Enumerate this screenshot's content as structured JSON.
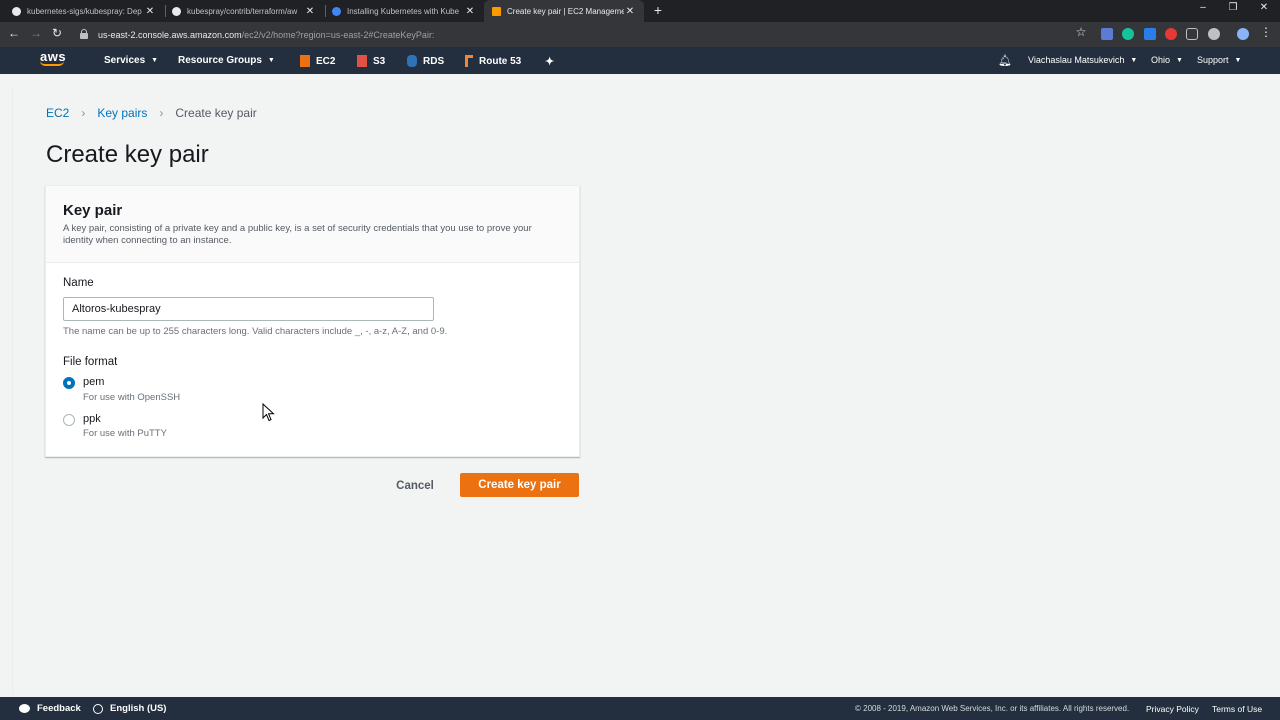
{
  "browser": {
    "tabs": [
      {
        "title": "kubernetes-sigs/kubespray: Dep",
        "favicon_color": "#1b1f23",
        "active": false
      },
      {
        "title": "kubespray/contrib/terraform/aw",
        "favicon_color": "#1b1f23",
        "active": false
      },
      {
        "title": "Installing Kubernetes with Kube",
        "favicon_color": "#4285f4",
        "active": false
      },
      {
        "title": "Create key pair | EC2 Manageme",
        "favicon_color": "#ff9900",
        "active": true
      }
    ],
    "url_host": "us-east-2.console.aws.amazon.com",
    "url_path": "/ec2/v2/home?region=us-east-2#CreateKeyPair:"
  },
  "aws_nav": {
    "logo": "aws",
    "services": "Services",
    "resource_groups": "Resource Groups",
    "shortcuts": [
      {
        "label": "EC2",
        "color": "#ec7211"
      },
      {
        "label": "S3",
        "color": "#e05243"
      },
      {
        "label": "RDS",
        "color": "#2e73b8"
      },
      {
        "label": "Route 53",
        "color": "#f58534"
      }
    ],
    "user": "Viachaslau Matsukevich",
    "region": "Ohio",
    "support": "Support"
  },
  "breadcrumb": {
    "items": [
      "EC2",
      "Key pairs"
    ],
    "current": "Create key pair"
  },
  "page_title": "Create key pair",
  "form": {
    "section_title": "Key pair",
    "section_description": "A key pair, consisting of a private key and a public key, is a set of security credentials that you use to prove your identity when connecting to an instance.",
    "name_label": "Name",
    "name_value": "Altoros-kubespray",
    "name_hint": "The name can be up to 255 characters long. Valid characters include _, -, a-z, A-Z, and 0-9.",
    "format_label": "File format",
    "formats": [
      {
        "label": "pem",
        "description": "For use with OpenSSH",
        "selected": true
      },
      {
        "label": "ppk",
        "description": "For use with PuTTY",
        "selected": false
      }
    ]
  },
  "actions": {
    "cancel": "Cancel",
    "create": "Create key pair"
  },
  "footer": {
    "feedback": "Feedback",
    "language": "English (US)",
    "copyright": "© 2008 - 2019, Amazon Web Services, Inc. or its affiliates. All rights reserved.",
    "privacy": "Privacy Policy",
    "terms": "Terms of Use"
  },
  "colors": {
    "aws_nav_bg": "#232f3e",
    "primary_button": "#ec7211",
    "link": "#0073bb"
  }
}
